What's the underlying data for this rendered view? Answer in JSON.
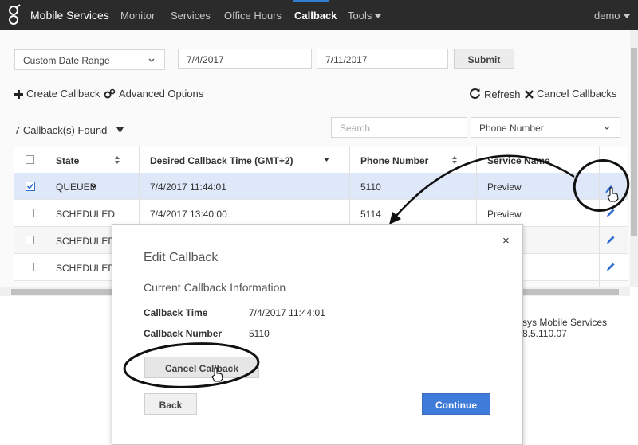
{
  "header": {
    "brand": "Mobile Services",
    "nav": [
      "Monitor",
      "Services",
      "Office Hours",
      "Callback",
      "Tools"
    ],
    "user": "demo"
  },
  "filters": {
    "date_range": "Custom Date Range",
    "start_date": "7/4/2017",
    "end_date": "7/11/2017",
    "submit": "Submit"
  },
  "actions": {
    "create": "Create Callback",
    "advanced": "Advanced Options",
    "refresh": "Refresh",
    "cancel": "Cancel Callbacks"
  },
  "list": {
    "found": "7 Callback(s) Found",
    "search_placeholder": "Search",
    "search_field": "Phone Number"
  },
  "table": {
    "headers": [
      "State",
      "Desired Callback Time (GMT+2)",
      "Phone Number",
      "Service Name"
    ],
    "rows": [
      {
        "state": "QUEUED",
        "time": "7/4/2017 11:44:01",
        "phone": "5110",
        "service": "Preview"
      },
      {
        "state": "SCHEDULED",
        "time": "7/4/2017 13:40:00",
        "phone": "5114",
        "service": "Preview"
      },
      {
        "state": "SCHEDULED",
        "time": "",
        "phone": "",
        "service": ""
      },
      {
        "state": "SCHEDULED",
        "time": "",
        "phone": "",
        "service": ""
      }
    ]
  },
  "footer": {
    "version": "sys Mobile Services 8.5.110.07"
  },
  "modal": {
    "close": "×",
    "title": "Edit Callback",
    "subtitle": "Current Callback Information",
    "time_label": "Callback Time",
    "time_value": "7/4/2017 11:44:01",
    "number_label": "Callback Number",
    "number_value": "5110",
    "cancel_button": "Cancel Callback",
    "back_button": "Back",
    "continue_button": "Continue"
  },
  "colors": {
    "accent": "#3f7bd9",
    "navbar": "#2b2b2b",
    "selected_row": "#dfe8f8"
  }
}
